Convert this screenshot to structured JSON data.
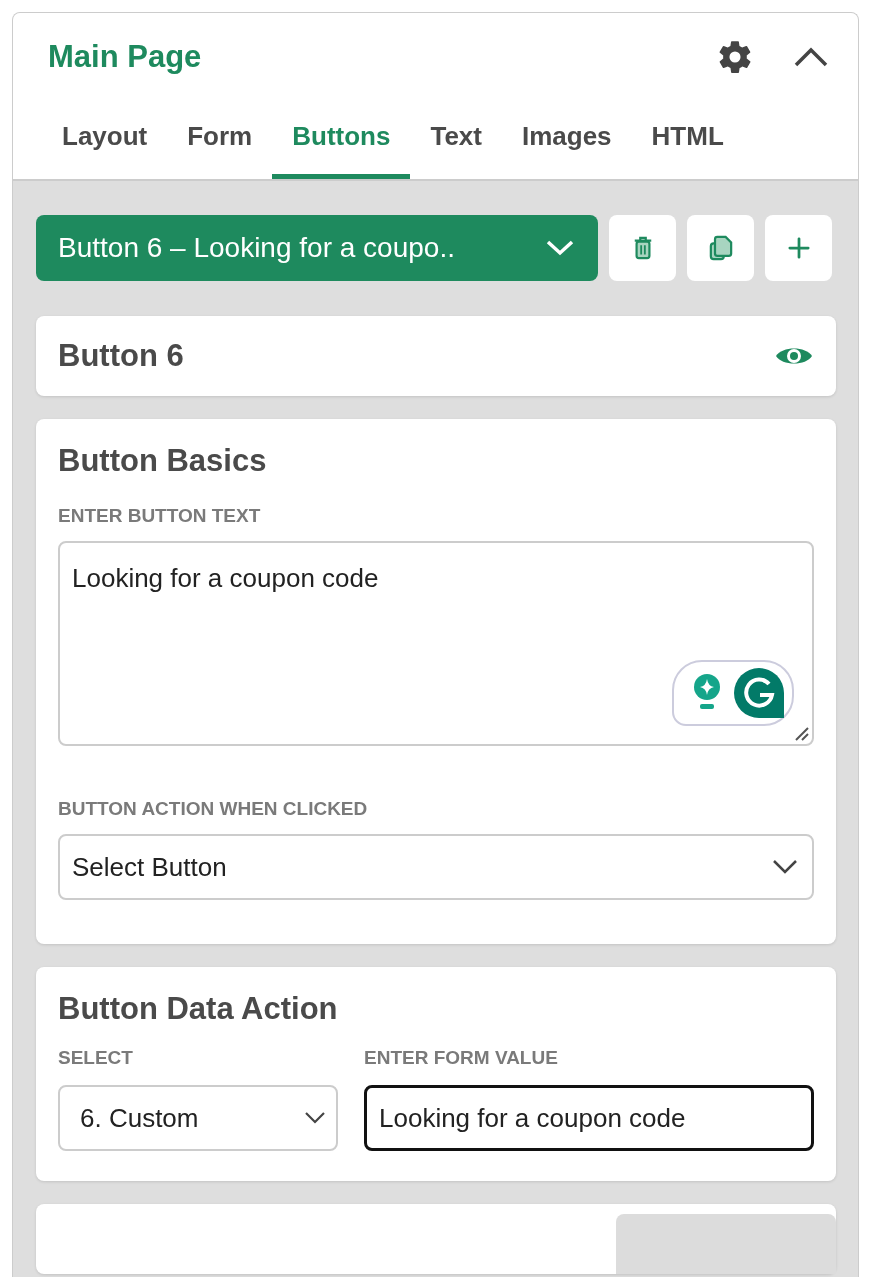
{
  "header": {
    "title": "Main Page"
  },
  "tabs": [
    {
      "label": "Layout",
      "selected": false
    },
    {
      "label": "Form",
      "selected": false
    },
    {
      "label": "Buttons",
      "selected": true
    },
    {
      "label": "Text",
      "selected": false
    },
    {
      "label": "Images",
      "selected": false
    },
    {
      "label": "HTML",
      "selected": false
    }
  ],
  "button_picker": {
    "value": "Button 6 – Looking for a coupo.."
  },
  "name_card": {
    "title": "Button 6"
  },
  "basics": {
    "title": "Button Basics",
    "text_label": "ENTER BUTTON TEXT",
    "text_value": "Looking for a coupon code",
    "action_label": "BUTTON ACTION WHEN CLICKED",
    "action_value": "Select Button"
  },
  "data_action": {
    "title": "Button Data Action",
    "select_label": "SELECT",
    "select_value": "6. Custom",
    "form_label": "ENTER FORM VALUE",
    "form_value": "Looking for a coupon code",
    "form_focused": true
  }
}
